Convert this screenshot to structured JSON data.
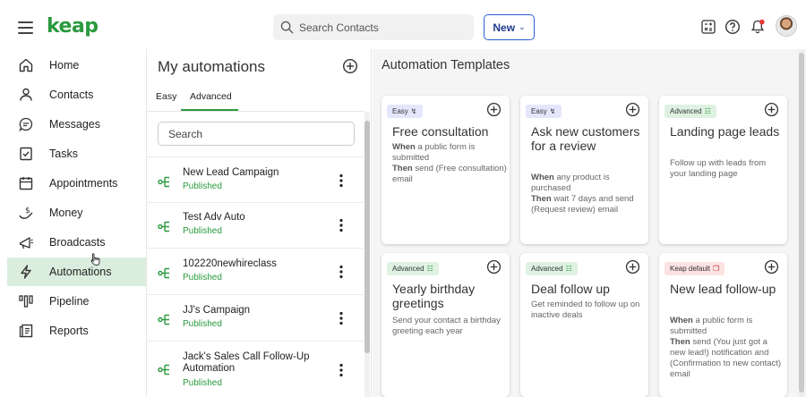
{
  "topbar": {
    "logo": "keap",
    "search_placeholder": "Search Contacts",
    "new_label": "New"
  },
  "nav": {
    "items": [
      {
        "label": "Home",
        "icon": "home-icon"
      },
      {
        "label": "Contacts",
        "icon": "person-icon"
      },
      {
        "label": "Messages",
        "icon": "chat-icon"
      },
      {
        "label": "Tasks",
        "icon": "checkbox-icon"
      },
      {
        "label": "Appointments",
        "icon": "calendar-icon"
      },
      {
        "label": "Money",
        "icon": "money-icon"
      },
      {
        "label": "Broadcasts",
        "icon": "megaphone-icon"
      },
      {
        "label": "Automations",
        "icon": "lightning-icon"
      },
      {
        "label": "Pipeline",
        "icon": "pipeline-icon"
      },
      {
        "label": "Reports",
        "icon": "report-icon"
      }
    ]
  },
  "automations": {
    "title": "My automations",
    "tabs": [
      "Easy",
      "Advanced"
    ],
    "search_placeholder": "Search",
    "list": [
      {
        "name": "New Lead Campaign",
        "status": "Published"
      },
      {
        "name": "Test Adv Auto",
        "status": "Published"
      },
      {
        "name": "102220newhireclass",
        "status": "Published"
      },
      {
        "name": "JJ's Campaign",
        "status": "Published"
      },
      {
        "name": "Jack's Sales Call Follow-Up Automation",
        "status": "Published"
      }
    ]
  },
  "templates": {
    "title": "Automation Templates",
    "cards": [
      {
        "badge": "Easy",
        "title": "Free consultation",
        "when_kw": "When",
        "when": " a public form is submitted",
        "then_kw": "Then",
        "then": " send (Free consultation) email"
      },
      {
        "badge": "Easy",
        "title": "Ask new customers for a review",
        "when_kw": "When",
        "when": " any product is purchased",
        "then_kw": "Then",
        "then": " wait 7 days and send (Request review) email"
      },
      {
        "badge": "Advanced",
        "title": "Landing page leads",
        "text": "Follow up with leads from your landing page"
      },
      {
        "badge": "Advanced",
        "title": "Yearly birthday greetings",
        "text": "Send your contact a birthday greeting each year"
      },
      {
        "badge": "Advanced",
        "title": "Deal follow up",
        "text": "Get reminded to follow up on inactive deals"
      },
      {
        "badge": "Keap default",
        "title": "New lead follow-up",
        "when_kw": "When",
        "when": " a public form is submitted",
        "then_kw": "Then",
        "then": " send (You just got a new lead!) notification and (Confirmation to new contact) email"
      }
    ]
  },
  "colors": {
    "brand_green": "#2a9a3e",
    "active_nav_bg": "#dbeedd",
    "new_button_border": "#2c5fd3",
    "notification_dot": "#e53935"
  }
}
